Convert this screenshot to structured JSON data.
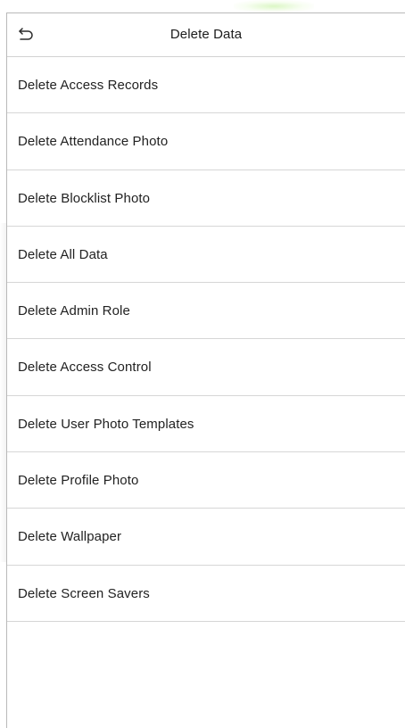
{
  "header": {
    "title": "Delete Data",
    "back_icon": "back-arrow-icon"
  },
  "menu": {
    "items": [
      {
        "label": "Delete Access Records"
      },
      {
        "label": "Delete Attendance Photo"
      },
      {
        "label": "Delete Blocklist Photo"
      },
      {
        "label": "Delete All Data"
      },
      {
        "label": "Delete Admin Role"
      },
      {
        "label": "Delete Access Control"
      },
      {
        "label": "Delete User Photo Templates"
      },
      {
        "label": "Delete Profile Photo"
      },
      {
        "label": "Delete Wallpaper"
      },
      {
        "label": "Delete Screen Savers"
      }
    ]
  },
  "colors": {
    "background": "#ffffff",
    "divider": "#d6d6d6",
    "text": "#222222"
  }
}
